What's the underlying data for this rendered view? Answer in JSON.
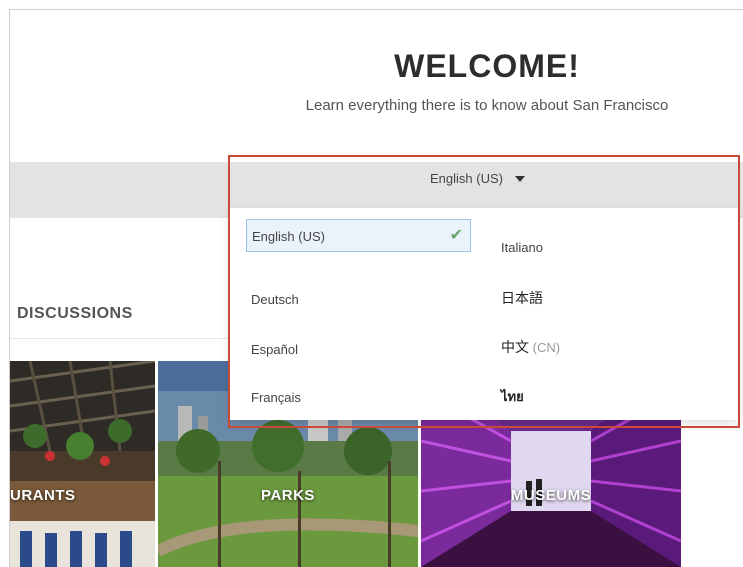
{
  "header": {
    "title": "WELCOME!",
    "subtitle": "Learn everything there is to know about San Francisco"
  },
  "language_selector": {
    "current": "English (US)",
    "icon": "caret-down-icon",
    "options": [
      {
        "label": "English (US)",
        "selected": true
      },
      {
        "label": "Deutsch",
        "selected": false
      },
      {
        "label": "Español",
        "selected": false
      },
      {
        "label": "Français",
        "selected": false
      },
      {
        "label": "Italiano",
        "selected": false
      },
      {
        "label": "日本語",
        "selected": false
      },
      {
        "label": "中文",
        "suffix": "(CN)",
        "selected": false
      },
      {
        "label": "ไทย",
        "selected": false
      }
    ],
    "selected_icon": "checkmark-icon",
    "highlight_color": "#c94a3b",
    "check_color": "#67a86a"
  },
  "section": {
    "discussions_label": "DISCUSSIONS"
  },
  "tiles": [
    {
      "label": "URANTS",
      "image": "restaurant-interior-image"
    },
    {
      "label": "PARKS",
      "image": "park-image"
    },
    {
      "label": "MUSEUMS",
      "image": "museum-tunnel-image"
    }
  ]
}
